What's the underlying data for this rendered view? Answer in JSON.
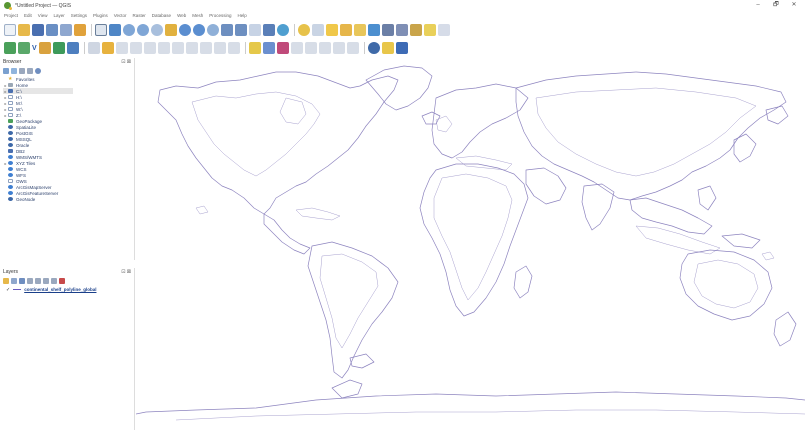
{
  "window": {
    "title": "*Untitled Project — QGIS",
    "controls": [
      "–",
      "🗗",
      "✕"
    ]
  },
  "menubar": [
    "Project",
    "Edit",
    "View",
    "Layer",
    "Settings",
    "Plugins",
    "Vector",
    "Raster",
    "Database",
    "Web",
    "Mesh",
    "Processing",
    "Help"
  ],
  "toolbar2": {
    "vector_label": "V"
  },
  "browser": {
    "title": "Browser",
    "ctl": "⊡ ⊠",
    "items": [
      {
        "label": "Favorites",
        "expander": "",
        "icon": "star"
      },
      {
        "label": "Home",
        "expander": "▸",
        "icon": "folder"
      },
      {
        "label": "C:\\",
        "expander": "▸",
        "icon": "drive"
      },
      {
        "label": "H:\\",
        "expander": "▸",
        "icon": "outline"
      },
      {
        "label": "M:\\",
        "expander": "▸",
        "icon": "outline"
      },
      {
        "label": "W:\\",
        "expander": "▸",
        "icon": "outline"
      },
      {
        "label": "Z:\\",
        "expander": "▸",
        "icon": "outline"
      },
      {
        "label": "GeoPackage",
        "expander": "",
        "icon": "green"
      },
      {
        "label": "SpatiaLite",
        "expander": "",
        "icon": "db"
      },
      {
        "label": "PostGIS",
        "expander": "",
        "icon": "db"
      },
      {
        "label": "MSSQL",
        "expander": "",
        "icon": "db"
      },
      {
        "label": "Oracle",
        "expander": "",
        "icon": "db"
      },
      {
        "label": "DB2",
        "expander": "",
        "icon": "drive"
      },
      {
        "label": "WMS/WMTS",
        "expander": "",
        "icon": "globe"
      },
      {
        "label": "XYZ Tiles",
        "expander": "▸",
        "icon": "globe"
      },
      {
        "label": "WCS",
        "expander": "",
        "icon": "globe"
      },
      {
        "label": "WFS",
        "expander": "",
        "icon": "globe"
      },
      {
        "label": "OWS",
        "expander": "",
        "icon": "outline"
      },
      {
        "label": "ArcGisMapServer",
        "expander": "",
        "icon": "globe"
      },
      {
        "label": "ArcGisFeatureServer",
        "expander": "",
        "icon": "globe"
      },
      {
        "label": "GeoNode",
        "expander": "",
        "icon": "db"
      }
    ]
  },
  "layers": {
    "title": "Layers",
    "ctl": "⊡ ⊠",
    "items": [
      {
        "name": "continental_shelf_polyline_global",
        "checked": "✓",
        "visible": true
      }
    ]
  },
  "colors": {
    "coastline": "#8d84bf",
    "accent_green": "#589632",
    "accent_blue": "#2a5aa8"
  }
}
